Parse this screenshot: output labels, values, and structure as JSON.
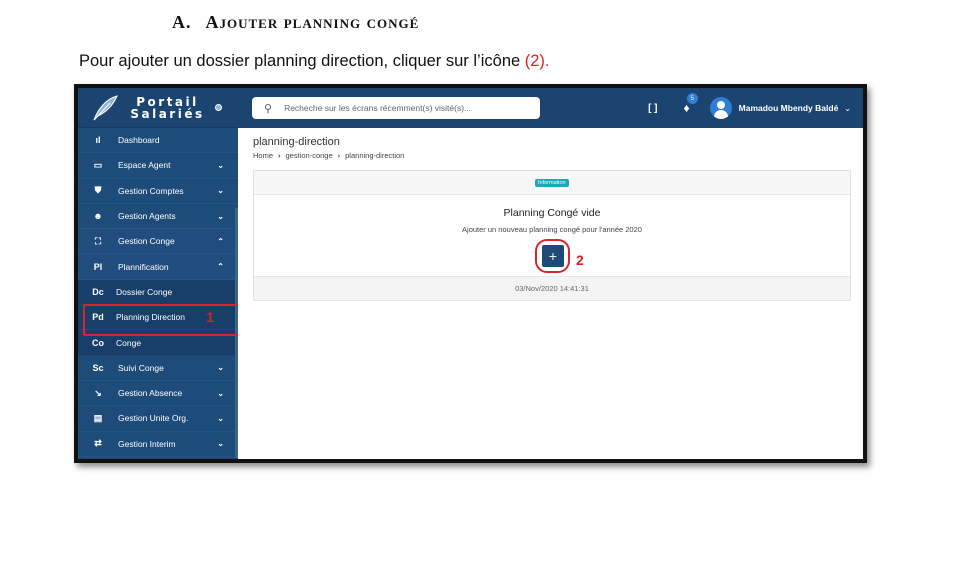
{
  "doc": {
    "heading_num": "A.",
    "heading_text": "Ajouter planning congé",
    "intro_text": "Pour ajouter un dossier planning direction, cliquer sur l’icône ",
    "intro_ref": "(2)."
  },
  "brand": {
    "line1": "Portail",
    "line2": "Salariés"
  },
  "sidebar": {
    "items": [
      {
        "icon": "bar-chart-icon",
        "glyph": "ıl",
        "label": "Dashboard",
        "chev": ""
      },
      {
        "icon": "card-icon",
        "glyph": "▭",
        "label": "Espace Agent",
        "chev": "⌄"
      },
      {
        "icon": "shield-icon",
        "glyph": "⛊",
        "label": "Gestion Comptes",
        "chev": "⌄"
      },
      {
        "icon": "agents-icon",
        "glyph": "☻",
        "label": "Gestion Agents",
        "chev": "⌄"
      },
      {
        "icon": "expand-icon",
        "glyph": "⛶",
        "label": "Gestion Conge",
        "chev": "⌃"
      },
      {
        "icon": "text-abbr",
        "glyph": "Pl",
        "label": "Plannification",
        "chev": "⌃"
      },
      {
        "icon": "text-abbr",
        "glyph": "Dc",
        "label": "Dossier Conge",
        "chev": ""
      },
      {
        "icon": "text-abbr",
        "glyph": "Pd",
        "label": "Planning Direction",
        "chev": ""
      },
      {
        "icon": "text-abbr",
        "glyph": "Co",
        "label": "Conge",
        "chev": ""
      },
      {
        "icon": "text-abbr",
        "glyph": "Sc",
        "label": "Suivi Conge",
        "chev": "⌄"
      },
      {
        "icon": "trend-icon",
        "glyph": "↘",
        "label": "Gestion Absence",
        "chev": "⌄"
      },
      {
        "icon": "store-icon",
        "glyph": "▤",
        "label": "Gestion Unite Org.",
        "chev": "⌄"
      },
      {
        "icon": "transfer-icon",
        "glyph": "⇄",
        "label": "Gestion Interim",
        "chev": "⌄"
      }
    ],
    "callout_1": "1"
  },
  "topbar": {
    "search_placeholder": "Recheche sur les écrans récemment(s) visité(s)...",
    "notif_count": "5",
    "user_name": "Mamadou Mbendy Baldé"
  },
  "content": {
    "title": "planning-direction",
    "crumbs": [
      "Home",
      "gestion-conge",
      "planning-direction"
    ],
    "badge": "Information",
    "empty_title": "Planning Congé vide",
    "empty_sub": "Ajouter un nouveau planning congé pour l'année 2020",
    "add_label": "+",
    "callout_2": "2",
    "footer_date": "03/Nov/2020 14:41:31"
  }
}
